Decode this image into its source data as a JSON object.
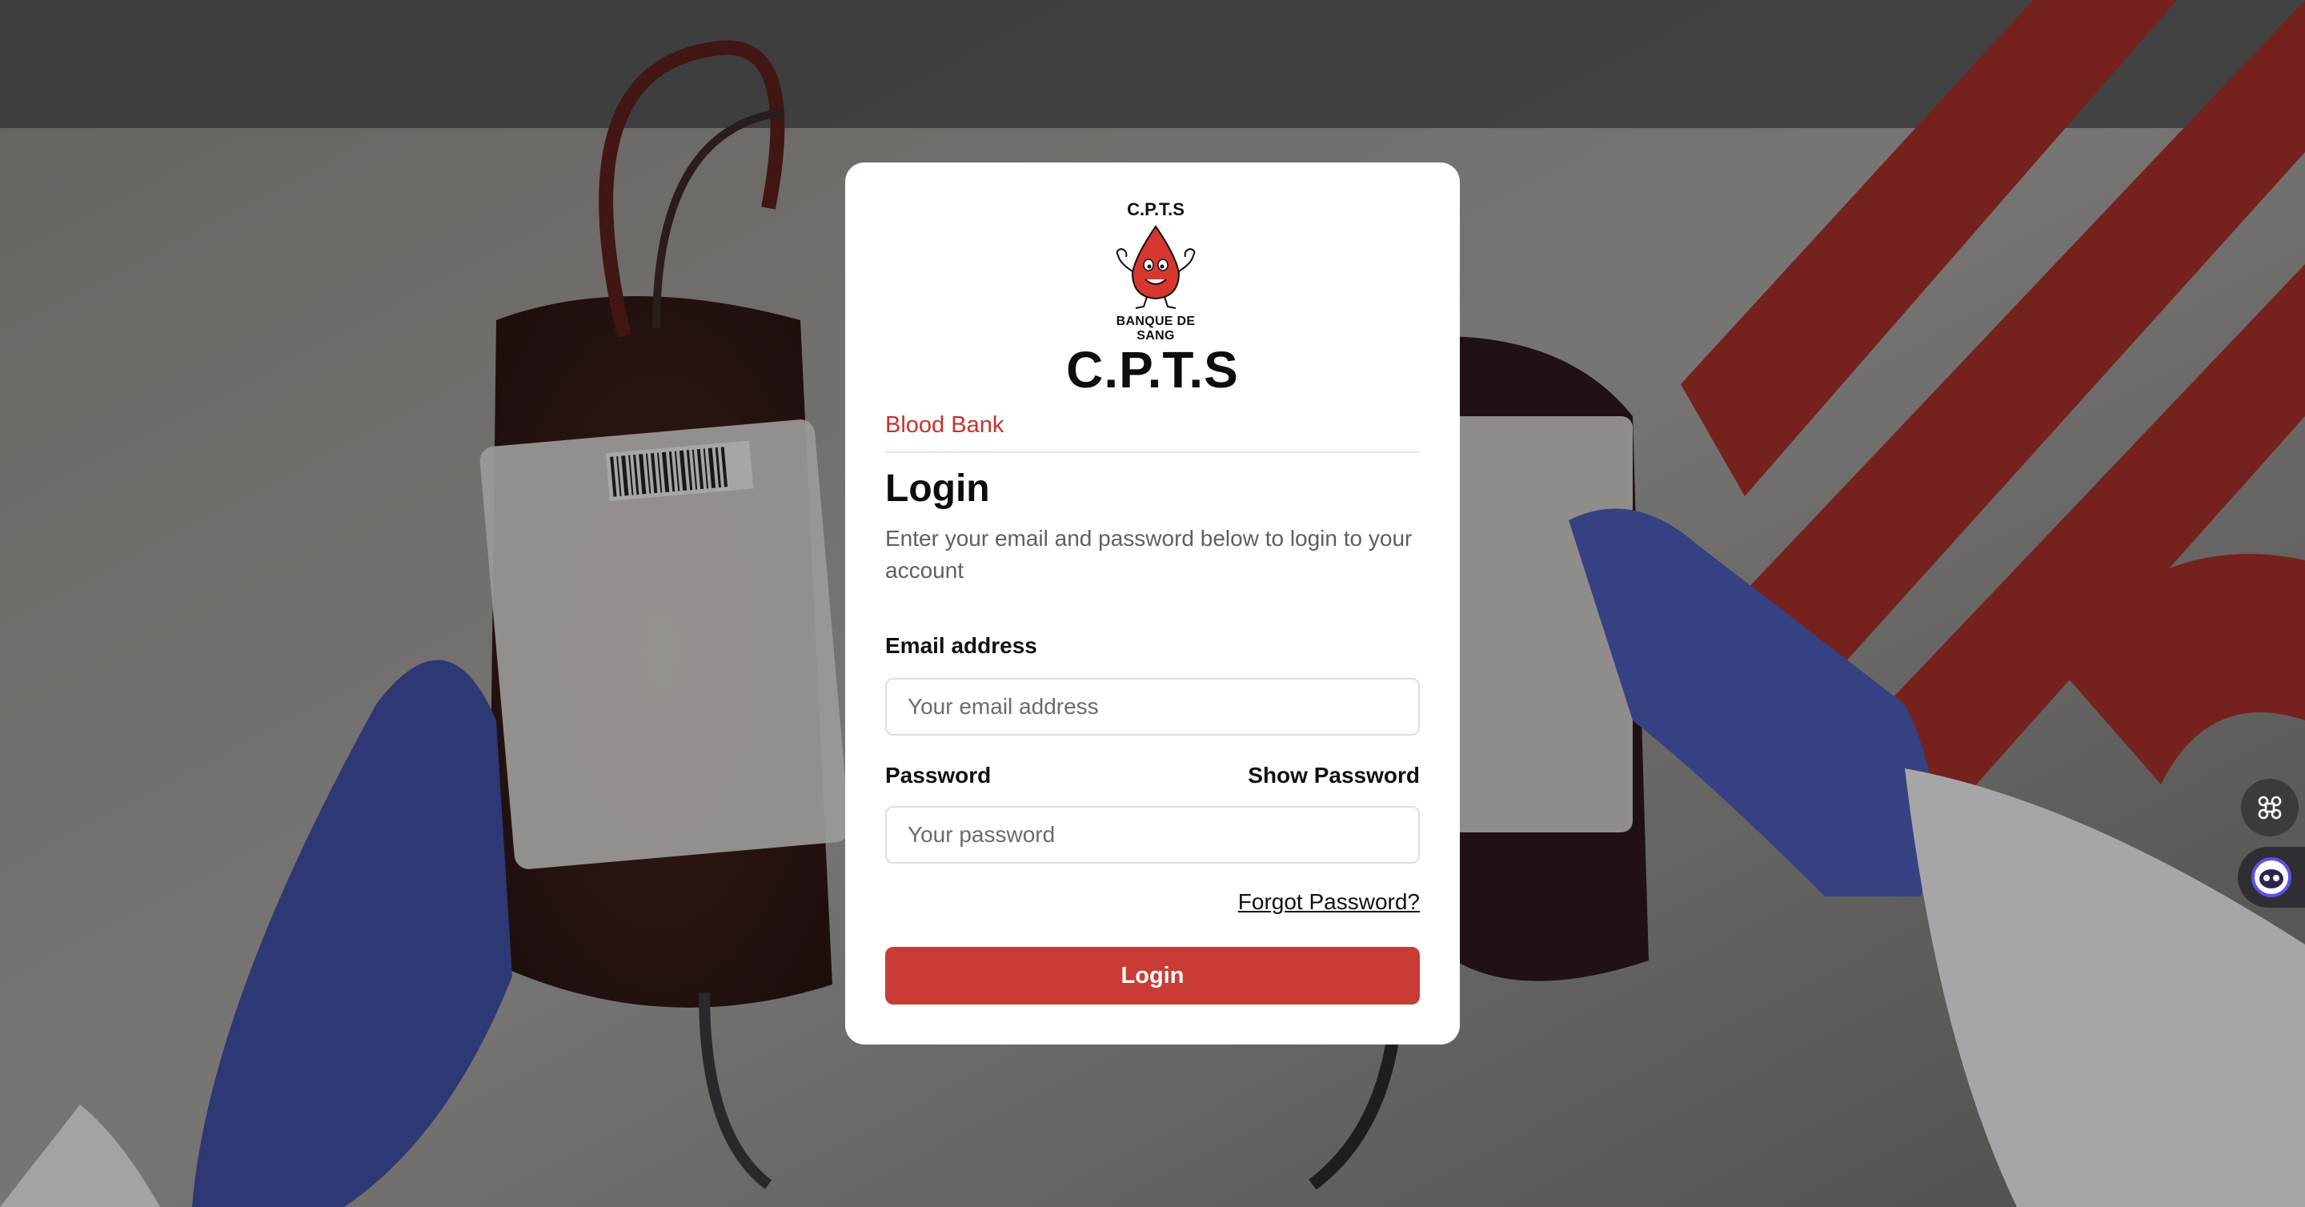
{
  "logo": {
    "top_text": "C.P.T.S",
    "bottom_text": "BANQUE DE SANG"
  },
  "brand": "C.P.T.S",
  "subtitle": "Blood Bank",
  "heading": "Login",
  "description": "Enter your email and password below to login to your account",
  "email": {
    "label": "Email address",
    "placeholder": "Your email address",
    "value": ""
  },
  "password": {
    "label": "Password",
    "toggle_label": "Show Password",
    "placeholder": "Your password",
    "value": ""
  },
  "forgot_label": "Forgot Password?",
  "login_button": "Login",
  "colors": {
    "accent": "#c93b35",
    "subtitle": "#c7322c"
  },
  "floating": {
    "command_icon": "command-icon",
    "assistant_icon": "assistant-bot-icon"
  }
}
